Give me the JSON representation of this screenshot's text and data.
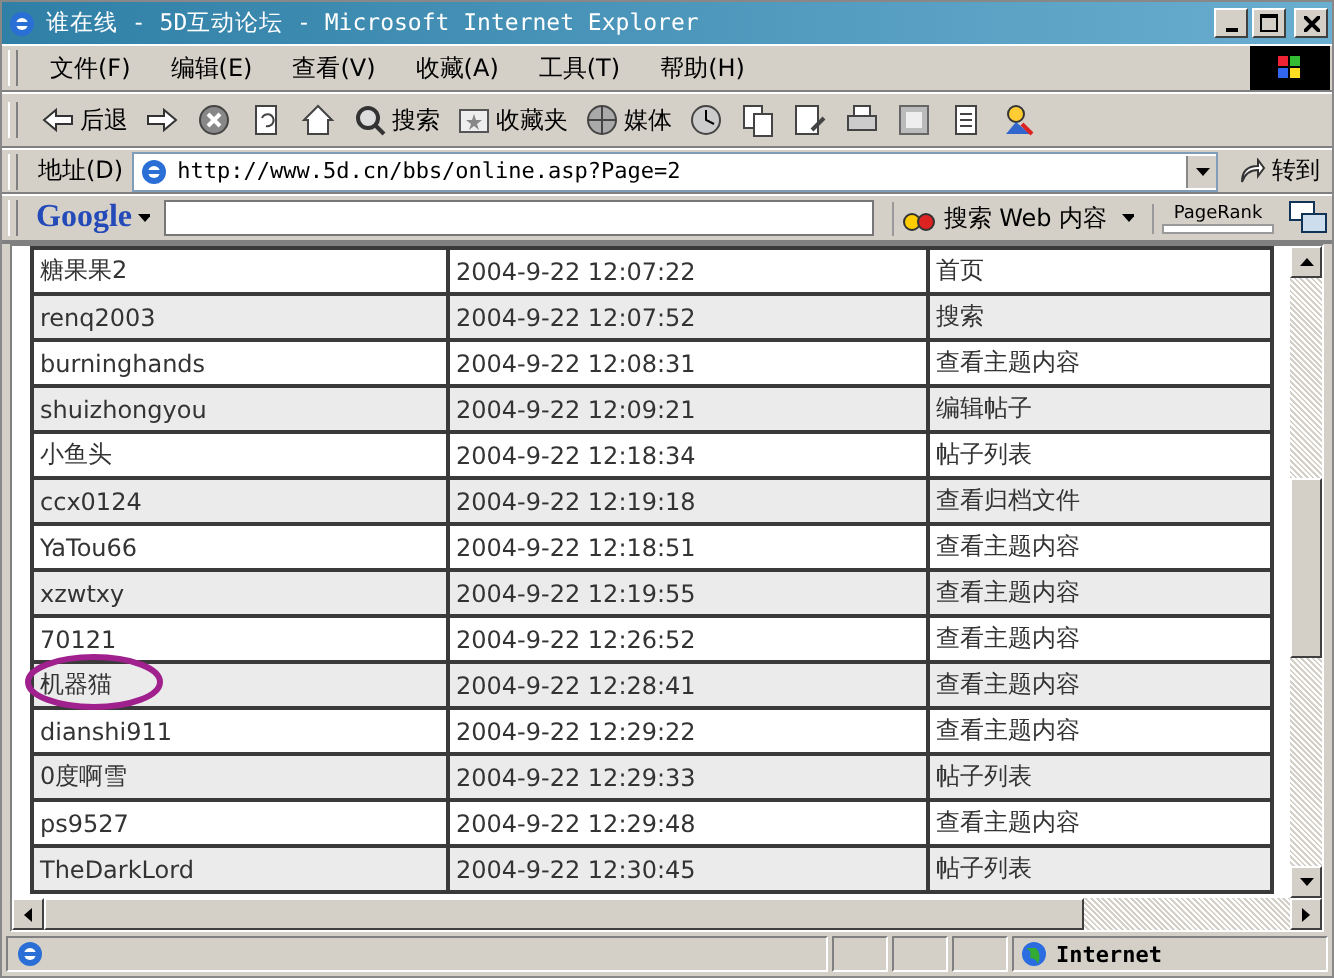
{
  "window": {
    "title": "谁在线 - 5D互动论坛 - Microsoft Internet Explorer"
  },
  "menu": [
    "文件(F)",
    "编辑(E)",
    "查看(V)",
    "收藏(A)",
    "工具(T)",
    "帮助(H)"
  ],
  "toolbar": [
    {
      "kind": "back",
      "label": "后退"
    },
    {
      "kind": "forward"
    },
    {
      "kind": "stop"
    },
    {
      "kind": "refresh"
    },
    {
      "kind": "home"
    },
    {
      "kind": "search",
      "label": "搜索"
    },
    {
      "kind": "favorites",
      "label": "收藏夹"
    },
    {
      "kind": "media",
      "label": "媒体"
    },
    {
      "kind": "history"
    },
    {
      "kind": "copy"
    },
    {
      "kind": "edit"
    },
    {
      "kind": "print"
    },
    {
      "kind": "window"
    },
    {
      "kind": "page"
    },
    {
      "kind": "messenger"
    }
  ],
  "address": {
    "label": "地址(D)",
    "url": "http://www.5d.cn/bbs/online.asp?Page=2",
    "go": "转到"
  },
  "google_bar": {
    "logo": "Google",
    "search_button": "搜索 Web 内容",
    "pagerank": "PageRank"
  },
  "table": {
    "rows": [
      {
        "name": "糖果果2",
        "time": "2004-9-22 12:07:22",
        "action": "首页",
        "circled": false
      },
      {
        "name": "renq2003",
        "time": "2004-9-22 12:07:52",
        "action": "搜索",
        "circled": false
      },
      {
        "name": "burninghands",
        "time": "2004-9-22 12:08:31",
        "action": "查看主题内容",
        "circled": false
      },
      {
        "name": "shuizhongyou",
        "time": "2004-9-22 12:09:21",
        "action": "编辑帖子",
        "circled": false
      },
      {
        "name": "小鱼头",
        "time": "2004-9-22 12:18:34",
        "action": "帖子列表",
        "circled": false
      },
      {
        "name": "ccx0124",
        "time": "2004-9-22 12:19:18",
        "action": "查看归档文件",
        "circled": false
      },
      {
        "name": "YaTou66",
        "time": "2004-9-22 12:18:51",
        "action": "查看主题内容",
        "circled": false
      },
      {
        "name": "xzwtxy",
        "time": "2004-9-22 12:19:55",
        "action": "查看主题内容",
        "circled": false
      },
      {
        "name": "70121",
        "time": "2004-9-22 12:26:52",
        "action": "查看主题内容",
        "circled": false
      },
      {
        "name": "机器猫",
        "time": "2004-9-22 12:28:41",
        "action": "查看主题内容",
        "circled": true
      },
      {
        "name": "dianshi911",
        "time": "2004-9-22 12:29:22",
        "action": "查看主题内容",
        "circled": false
      },
      {
        "name": "0度啊雪",
        "time": "2004-9-22 12:29:33",
        "action": "帖子列表",
        "circled": false
      },
      {
        "name": "ps9527",
        "time": "2004-9-22 12:29:48",
        "action": "查看主题内容",
        "circled": false
      },
      {
        "name": "TheDarkLord",
        "time": "2004-9-22 12:30:45",
        "action": "帖子列表",
        "circled": false
      }
    ]
  },
  "status_bar": {
    "zone": "Internet"
  }
}
